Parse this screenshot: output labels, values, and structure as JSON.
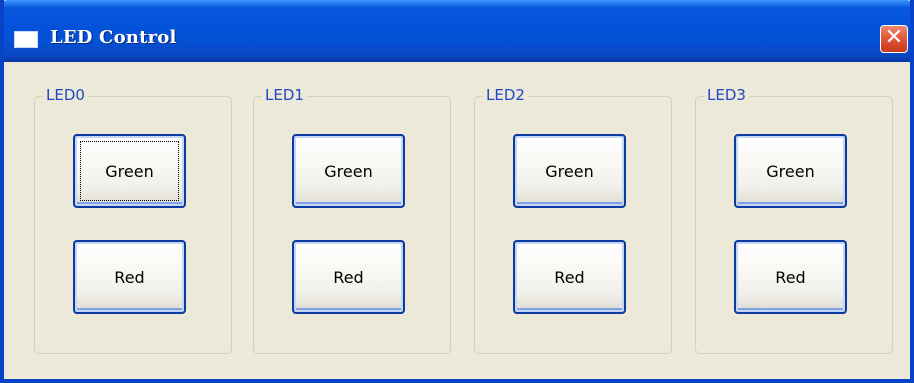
{
  "window": {
    "title": "LED Control",
    "close_symbol": "✕"
  },
  "groups": [
    {
      "label": "LED0",
      "green_label": "Green",
      "red_label": "Red"
    },
    {
      "label": "LED1",
      "green_label": "Green",
      "red_label": "Red"
    },
    {
      "label": "LED2",
      "green_label": "Green",
      "red_label": "Red"
    },
    {
      "label": "LED3",
      "green_label": "Green",
      "red_label": "Red"
    }
  ],
  "icons": {
    "app": "window-icon",
    "close": "close-icon"
  },
  "colors": {
    "titlebar": "#0553dc",
    "window_face": "#ece9d8",
    "group_label": "#2147c8",
    "close_button": "#e15a3a"
  }
}
